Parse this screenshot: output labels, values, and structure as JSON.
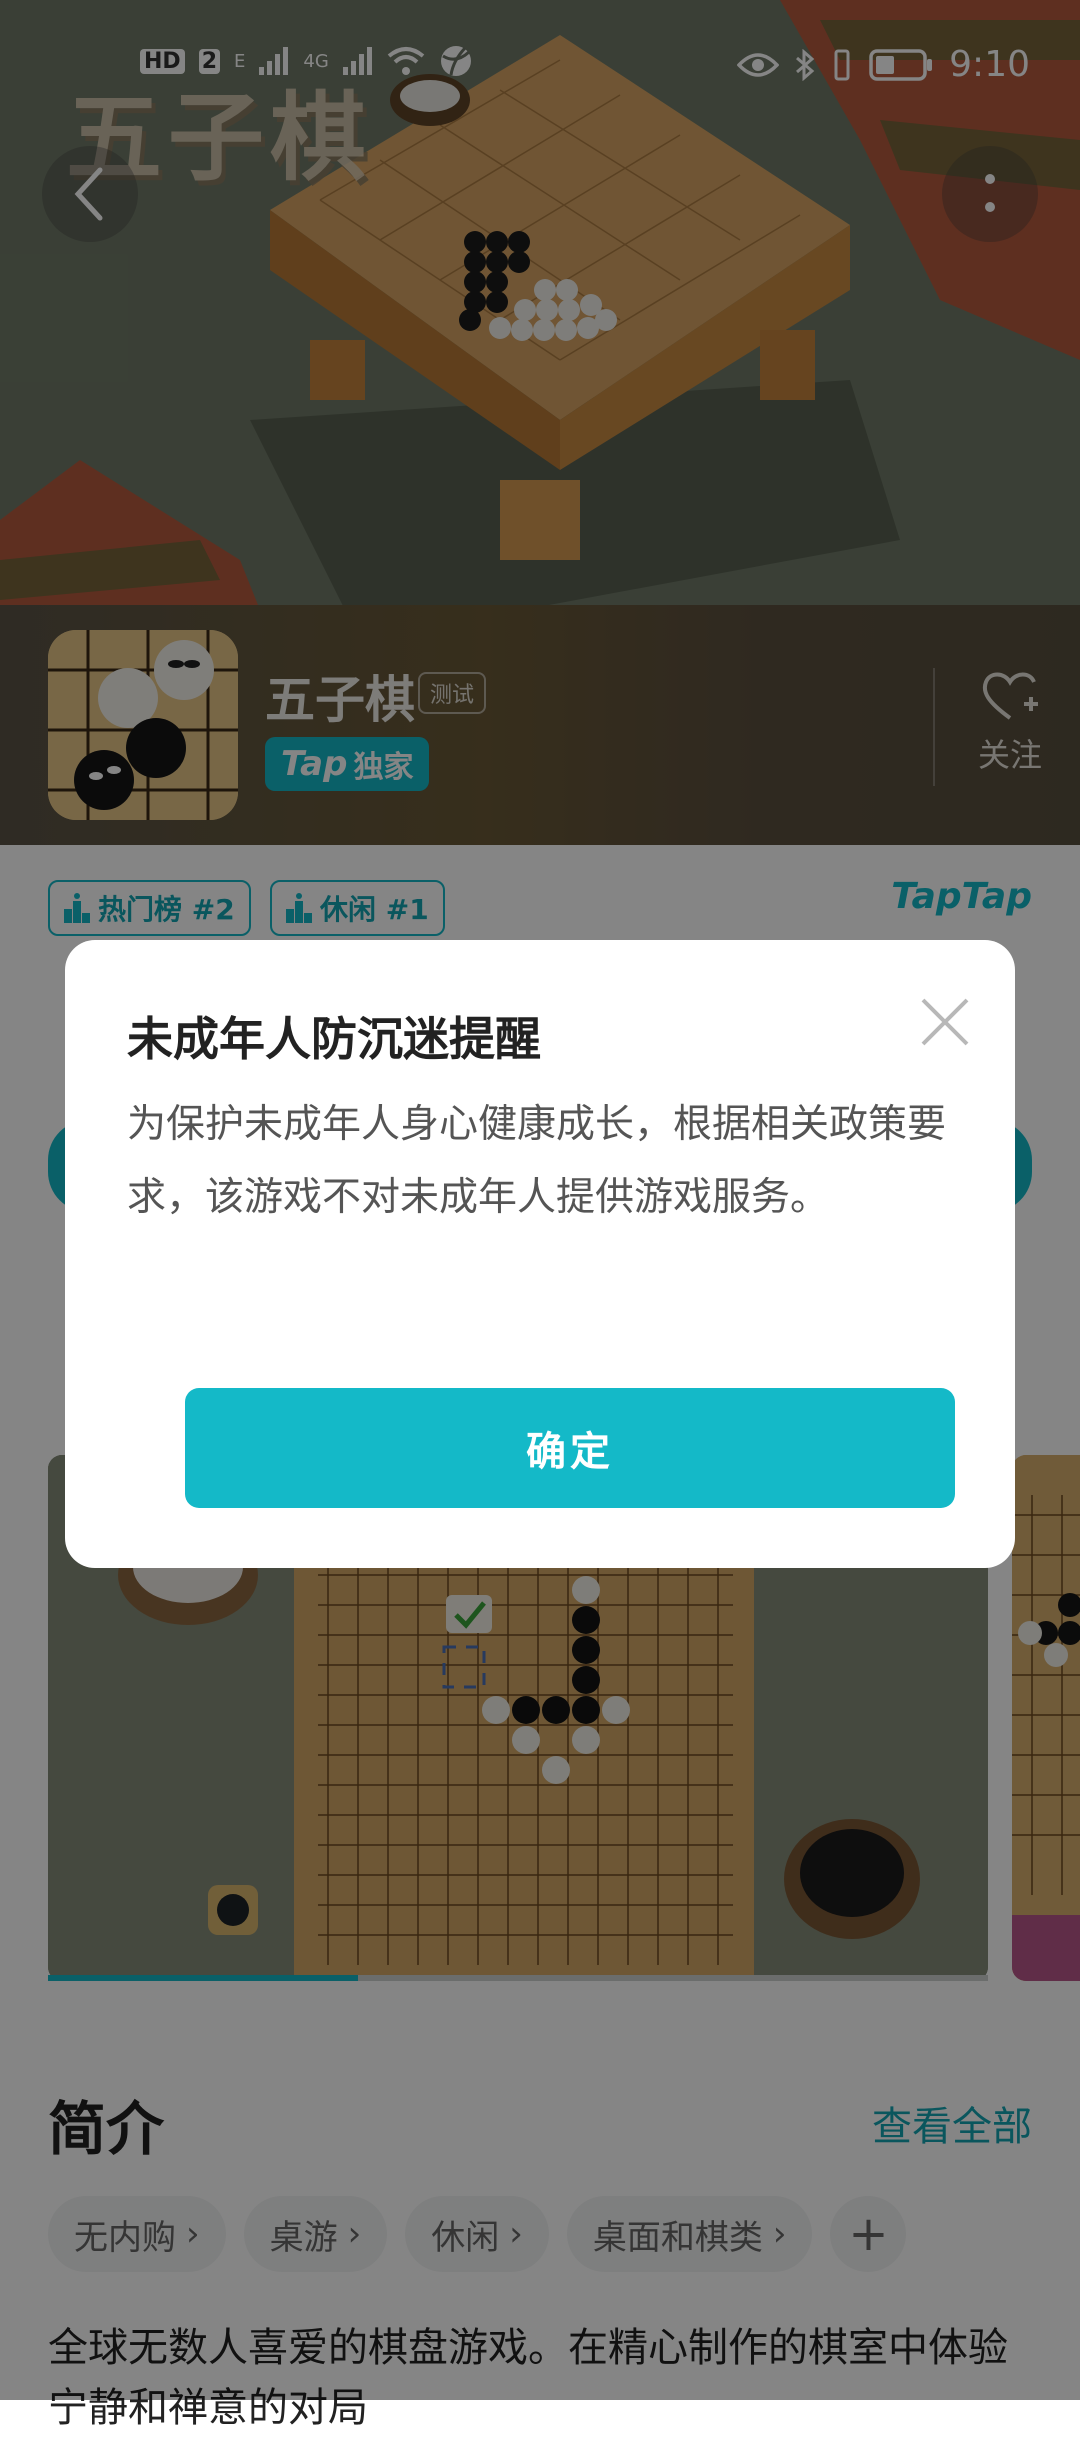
{
  "status_bar": {
    "left_badges": [
      "HD",
      "2",
      "E",
      "4G"
    ],
    "time": "9:10",
    "icons": [
      "signal-icon",
      "wifi-icon",
      "basketball-icon",
      "eye-icon",
      "bluetooth-icon",
      "vibrate-icon",
      "battery-icon"
    ]
  },
  "hero": {
    "logo_text": "五子棋"
  },
  "app": {
    "name": "五子棋",
    "test_badge": "测试",
    "tap_word": "Tap",
    "exclusive_label": "独家",
    "follow_label": "关注"
  },
  "ranks": [
    {
      "label": "热门榜 #2"
    },
    {
      "label": "休闲 #1"
    }
  ],
  "taptap_logo": "TapTap",
  "intro": {
    "title": "简介",
    "view_all": "查看全部",
    "chips": [
      "无内购",
      "桌游",
      "休闲",
      "桌面和棋类"
    ],
    "chip_add": "+",
    "description": "全球无数人喜爱的棋盘游戏。在精心制作的棋室中体验宁静和禅意的对局"
  },
  "screenshots": {
    "progress": 0.33
  },
  "dialog": {
    "title": "未成年人防沉迷提醒",
    "body": "为保护未成年人身心健康成长，根据相关政策要求，该游戏不对未成年人提供游戏服务。",
    "confirm": "确定"
  },
  "colors": {
    "accent": "#14b9c8",
    "overlay": "rgba(0,0,0,0.48)"
  }
}
